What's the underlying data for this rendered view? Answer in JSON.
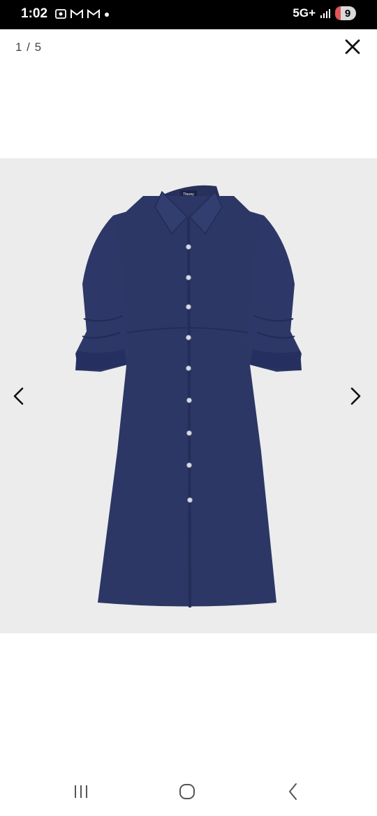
{
  "status_bar": {
    "time": "1:02",
    "network": "5G+",
    "battery": "9",
    "left_icons": [
      "screenshot-icon",
      "gmail-icon",
      "gmail-icon",
      "dot-icon"
    ],
    "right_icons": [
      "signal-icon",
      "battery-icon"
    ]
  },
  "viewer": {
    "page_counter": "1 / 5",
    "close_icon": "close-icon",
    "prev_icon": "chevron-left-icon",
    "next_icon": "chevron-right-icon",
    "stage_bg": "#ececec"
  },
  "product": {
    "label_text": "Theory",
    "dress_color": "#2c3766"
  },
  "nav_bar": {
    "icons": [
      "recents-icon",
      "home-icon",
      "back-icon"
    ]
  }
}
